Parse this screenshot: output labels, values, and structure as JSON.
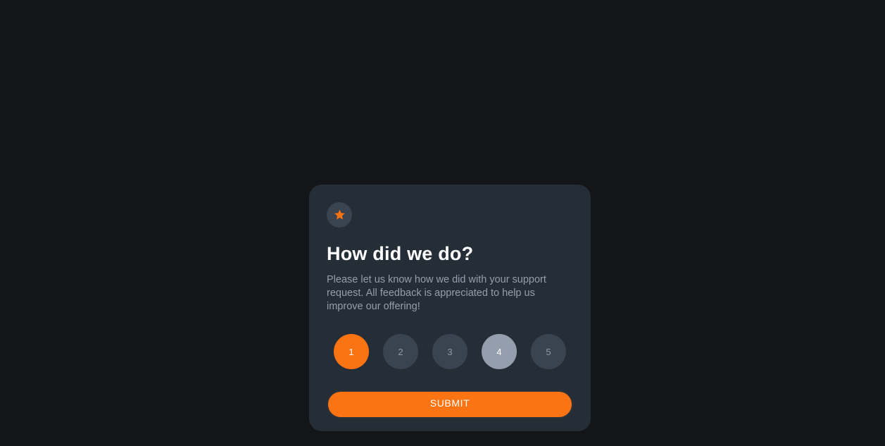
{
  "card": {
    "icon": "star-icon",
    "title": "How did we do?",
    "description": "Please let us know how we did with your support request. All feedback is appreciated to help us improve our offering!"
  },
  "ratings": {
    "options": [
      "1",
      "2",
      "3",
      "4",
      "5"
    ],
    "selected": "1",
    "hovered": "4"
  },
  "submit": {
    "label": "SUBMIT"
  },
  "colors": {
    "page_background": "#131518",
    "card_background": "#252d37",
    "accent": "#fb7413",
    "rating_default": "#3a4350",
    "rating_hover": "#959eac",
    "text_primary": "#ffffff",
    "text_muted": "#959eac"
  }
}
